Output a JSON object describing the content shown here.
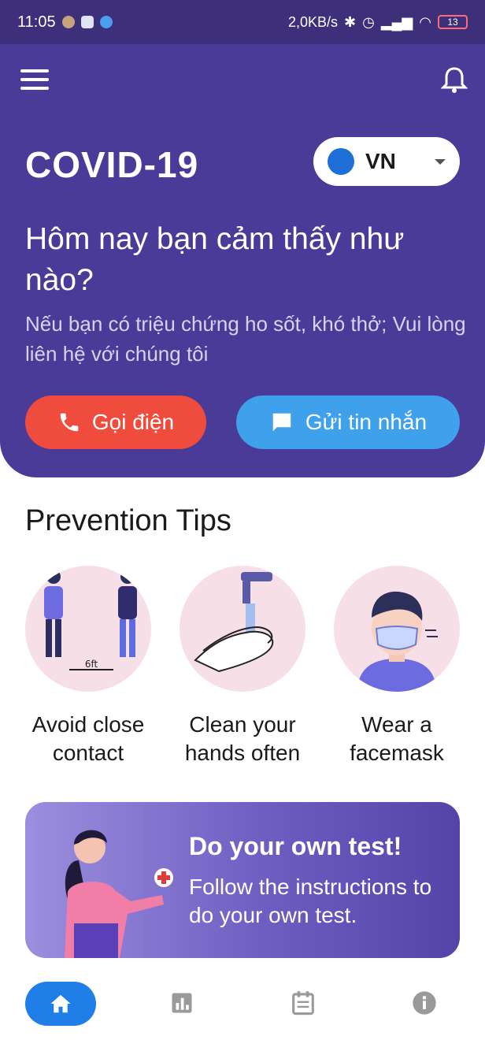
{
  "status_bar": {
    "time": "11:05",
    "network_speed": "2,0KB/s",
    "battery": "13"
  },
  "header": {
    "app_title": "COVID-19",
    "country_code": "VN",
    "question": "Hôm nay bạn cảm thấy như nào?",
    "subtext": "Nếu bạn có triệu chứng ho sốt, khó thở; Vui lòng liên hệ với chúng tôi",
    "call_label": "Gọi điện",
    "message_label": "Gửi tin nhắn"
  },
  "prevention": {
    "title": "Prevention Tips",
    "tips": [
      {
        "label": "Avoid close contact",
        "icon": "social-distance-icon",
        "annotation": "6ft"
      },
      {
        "label": "Clean your hands often",
        "icon": "wash-hands-icon"
      },
      {
        "label": "Wear a facemask",
        "icon": "facemask-icon"
      }
    ]
  },
  "test_card": {
    "heading": "Do your own test!",
    "description": "Follow the instructions to do your own test."
  },
  "bottom_nav": {
    "items": [
      "home-icon",
      "chart-icon",
      "calendar-icon",
      "info-icon"
    ]
  },
  "colors": {
    "header_bg": "#4a3b98",
    "call_button": "#f04c3e",
    "message_button": "#3fa0ec",
    "active_nav": "#1f7ee8"
  }
}
